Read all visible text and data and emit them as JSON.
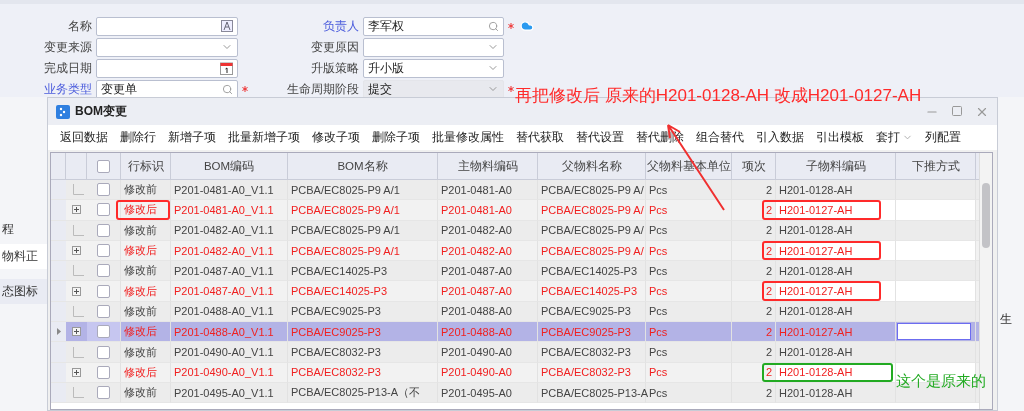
{
  "form": {
    "left": [
      {
        "label": "名称",
        "kind": "text",
        "link": false,
        "required": false
      },
      {
        "label": "变更来源",
        "kind": "select",
        "link": false,
        "required": false
      },
      {
        "label": "完成日期",
        "kind": "date",
        "link": false,
        "required": false
      },
      {
        "label": "业务类型",
        "kind": "lookup",
        "value": "变更单",
        "link": true,
        "required": true
      }
    ],
    "right": [
      {
        "label": "负责人",
        "kind": "lookup",
        "value": "李军权",
        "link": true,
        "required": true,
        "disabled": false
      },
      {
        "label": "变更原因",
        "kind": "select",
        "link": false,
        "required": false,
        "disabled": false
      },
      {
        "label": "升版策略",
        "kind": "select",
        "value": "升小版",
        "link": false,
        "required": false,
        "disabled": false
      },
      {
        "label": "生命周期阶段",
        "kind": "select",
        "value": "提交",
        "link": false,
        "required": true,
        "disabled": true
      }
    ]
  },
  "background_page": {
    "left": [
      "程",
      "物料正",
      "态图标"
    ],
    "right": [
      "生"
    ]
  },
  "dialog": {
    "title": "BOM变更",
    "toolbar": [
      {
        "label": "返回数据",
        "kind": "button"
      },
      {
        "label": "删除行",
        "kind": "button"
      },
      {
        "label": "新增子项",
        "kind": "button"
      },
      {
        "label": "批量新增子项",
        "kind": "button"
      },
      {
        "label": "修改子项",
        "kind": "button"
      },
      {
        "label": "删除子项",
        "kind": "button"
      },
      {
        "label": "批量修改属性",
        "kind": "button"
      },
      {
        "label": "替代获取",
        "kind": "button"
      },
      {
        "label": "替代设置",
        "kind": "button"
      },
      {
        "label": "替代删除",
        "kind": "button"
      },
      {
        "label": "组合替代",
        "kind": "button"
      },
      {
        "label": "引入数据",
        "kind": "button"
      },
      {
        "label": "引出模板",
        "kind": "button"
      },
      {
        "label": "套打",
        "kind": "dropdown"
      },
      {
        "label": "列配置",
        "kind": "button"
      }
    ],
    "table": {
      "all_checked": false,
      "columns": [
        {
          "label": "行标识",
          "kind": "text"
        },
        {
          "label": "BOM编码",
          "kind": "text"
        },
        {
          "label": "BOM名称",
          "kind": "text"
        },
        {
          "label": "主物料编码",
          "kind": "text"
        },
        {
          "label": "父物料名称",
          "kind": "text"
        },
        {
          "label": "父物料基本单位",
          "kind": "text"
        },
        {
          "label": "项次",
          "kind": "number"
        },
        {
          "label": "子物料编码",
          "kind": "text"
        },
        {
          "label": "下推方式"
        }
      ],
      "rows": [
        {
          "kind": "before",
          "selected": false,
          "checked": false,
          "cells": [
            "修改前",
            "P201-0481-A0_V1.1",
            "PCBA/EC8025-P9 A/1",
            "P201-0481-A0",
            "PCBA/EC8025-P9 A/",
            "Pcs",
            "2",
            "H201-0128-AH"
          ]
        },
        {
          "kind": "after",
          "selected": false,
          "checked": false,
          "cells": [
            "修改后",
            "P201-0481-A0_V1.1",
            "PCBA/EC8025-P9 A/1",
            "P201-0481-A0",
            "PCBA/EC8025-P9 A/",
            "Pcs",
            "2",
            "H201-0127-AH"
          ],
          "callouts": [
            {
              "kind": "flag",
              "color": "#ff2a2a"
            },
            {
              "kind": "child",
              "color": "#ff2a2a"
            }
          ]
        },
        {
          "kind": "before",
          "selected": false,
          "checked": false,
          "cells": [
            "修改前",
            "P201-0482-A0_V1.1",
            "PCBA/EC8025-P9 A/1",
            "P201-0482-A0",
            "PCBA/EC8025-P9 A/",
            "Pcs",
            "2",
            "H201-0128-AH"
          ]
        },
        {
          "kind": "after",
          "selected": false,
          "checked": false,
          "cells": [
            "修改后",
            "P201-0482-A0_V1.1",
            "PCBA/EC8025-P9 A/1",
            "P201-0482-A0",
            "PCBA/EC8025-P9 A/",
            "Pcs",
            "2",
            "H201-0127-AH"
          ],
          "callouts": [
            {
              "kind": "child",
              "color": "#ff2a2a"
            }
          ]
        },
        {
          "kind": "before",
          "selected": false,
          "checked": false,
          "cells": [
            "修改前",
            "P201-0487-A0_V1.1",
            "PCBA/EC14025-P3",
            "P201-0487-A0",
            "PCBA/EC14025-P3",
            "Pcs",
            "2",
            "H201-0128-AH"
          ]
        },
        {
          "kind": "after",
          "selected": false,
          "checked": false,
          "cells": [
            "修改后",
            "P201-0487-A0_V1.1",
            "PCBA/EC14025-P3",
            "P201-0487-A0",
            "PCBA/EC14025-P3",
            "Pcs",
            "2",
            "H201-0127-AH"
          ],
          "callouts": [
            {
              "kind": "child",
              "color": "#ff2a2a"
            }
          ]
        },
        {
          "kind": "before",
          "selected": false,
          "checked": false,
          "cells": [
            "修改前",
            "P201-0488-A0_V1.1",
            "PCBA/EC9025-P3",
            "P201-0488-A0",
            "PCBA/EC9025-P3",
            "Pcs",
            "2",
            "H201-0128-AH"
          ]
        },
        {
          "kind": "after",
          "selected": true,
          "checked": false,
          "cells": [
            "修改后",
            "P201-0488-A0_V1.1",
            "PCBA/EC9025-P3",
            "P201-0488-A0",
            "PCBA/EC9025-P3",
            "Pcs",
            "2",
            "H201-0127-AH"
          ]
        },
        {
          "kind": "before",
          "selected": false,
          "checked": false,
          "cells": [
            "修改前",
            "P201-0490-A0_V1.1",
            "PCBA/EC8032-P3",
            "P201-0490-A0",
            "PCBA/EC8032-P3",
            "Pcs",
            "2",
            "H201-0128-AH"
          ]
        },
        {
          "kind": "after",
          "selected": false,
          "checked": false,
          "cells": [
            "修改后",
            "P201-0490-A0_V1.1",
            "PCBA/EC8032-P3",
            "P201-0490-A0",
            "PCBA/EC8032-P3",
            "Pcs",
            "2",
            "H201-0128-AH"
          ],
          "callouts": [
            {
              "kind": "child",
              "color": "#22aa22"
            }
          ]
        },
        {
          "kind": "before",
          "selected": false,
          "checked": false,
          "cells": [
            "修改前",
            "P201-0495-A0_V1.1",
            "PCBA/EC8025-P13-A（不",
            "P201-0495-A0",
            "PCBA/EC8025-P13-A",
            "Pcs",
            "2",
            "H201-0128-AH"
          ]
        }
      ]
    }
  },
  "annotations": [
    {
      "kind": "instruction",
      "text": "再把修改后 原来的H201-0128-AH 改成H201-0127-AH",
      "color": "#ff2a2a"
    },
    {
      "kind": "note",
      "text": "这个是原来的",
      "color": "#22aa22"
    }
  ]
}
